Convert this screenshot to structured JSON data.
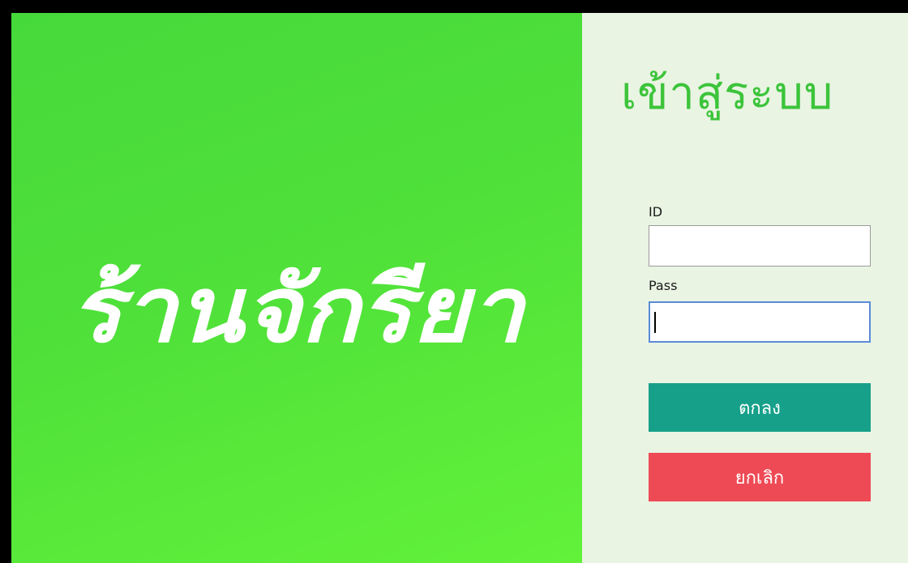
{
  "brand": {
    "logo_text": "ร้านจักรียา",
    "background_color": "#4fe03a"
  },
  "login": {
    "title": "เข้าสู่ระบบ",
    "id_label": "ID",
    "id_value": "",
    "pass_label": "Pass",
    "pass_value": "",
    "ok_label": "ตกลง",
    "cancel_label": "ยกเลิก"
  },
  "colors": {
    "title": "#3cc43a",
    "ok_button": "#16a08a",
    "cancel_button": "#ee4a55",
    "panel_background": "#e9f4e3"
  }
}
